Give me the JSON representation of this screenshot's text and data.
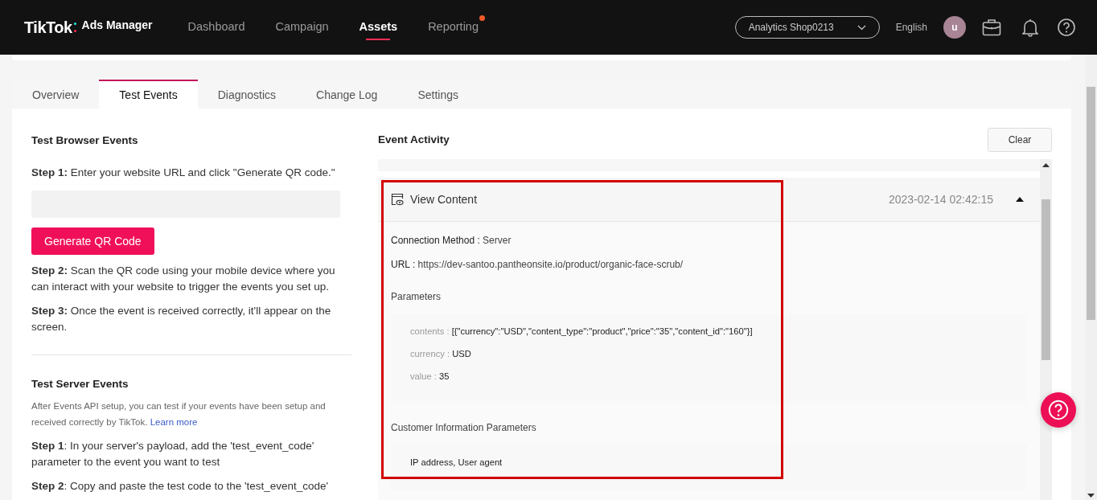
{
  "header": {
    "logo": "TikTok",
    "logo_suffix": "Ads Manager",
    "nav": [
      {
        "label": "Dashboard",
        "selected": false,
        "dot": false
      },
      {
        "label": "Campaign",
        "selected": false,
        "dot": false
      },
      {
        "label": "Assets",
        "selected": true,
        "dot": false
      },
      {
        "label": "Reporting",
        "selected": false,
        "dot": true
      }
    ],
    "account": "Analytics Shop0213",
    "language": "English",
    "avatar": "u"
  },
  "tabs": [
    {
      "label": "Overview",
      "selected": false
    },
    {
      "label": "Test Events",
      "selected": true
    },
    {
      "label": "Diagnostics",
      "selected": false
    },
    {
      "label": "Change Log",
      "selected": false
    },
    {
      "label": "Settings",
      "selected": false
    }
  ],
  "browser_events": {
    "title": "Test Browser Events",
    "step1": "**Step 1:** Enter your website URL and click \"Generate QR code.\"",
    "button": "Generate QR Code",
    "steps": [
      "**Step 2:** Scan the QR code using your mobile device where you can interact with your website to trigger the events you set up.",
      "**Step 3:** Once the event is received correctly, it'll appear on the screen."
    ]
  },
  "server_events": {
    "title": "Test Server Events",
    "description": "After Events API setup, you can test if your events have been setup and received correctly by TikTok.",
    "link": "Learn more",
    "steps": [
      "**Step 1**: In your server's payload, add the 'test_event_code' parameter to the event you want to test",
      "**Step 2**: Copy and paste the test code to the 'test_event_code'"
    ]
  },
  "event_activity": {
    "title": "Event Activity",
    "clear_button": "Clear",
    "events": [
      {
        "name": "View Content",
        "time": "2023-02-14 02:42:15",
        "expanded": true,
        "highlighted": true,
        "connection_label": "Connection Method :",
        "connection": "Server",
        "url_label": "URL :",
        "url": "https://dev-santoo.pantheonsite.io/product/organic-face-scrub/",
        "parameters_title": "Parameters",
        "parameters": [
          {
            "key": "contents :",
            "value": "[{\"currency\":\"USD\",\"content_type\":\"product\",\"price\":\"35\",\"content_id\":\"160\"}]"
          },
          {
            "key": "currency :",
            "value": "USD"
          },
          {
            "key": "value :",
            "value": "35"
          }
        ],
        "customer_title": "Customer Information Parameters",
        "customer_info": "IP address, User agent"
      }
    ]
  }
}
